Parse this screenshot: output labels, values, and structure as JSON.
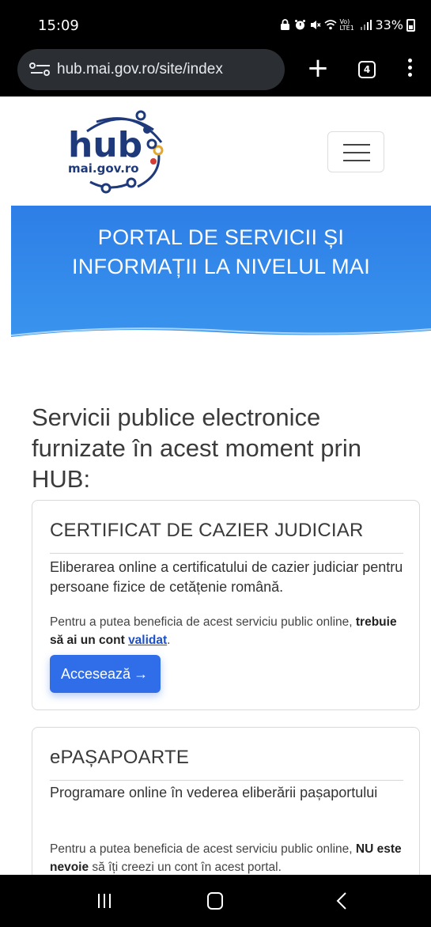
{
  "status_bar": {
    "time": "15:09",
    "network_label": "Vo) LTE1",
    "battery": "33%"
  },
  "browser": {
    "url": "hub.mai.gov.ro/site/index",
    "tabs_count": "4"
  },
  "logo": {
    "word": "hub",
    "domain": "mai.gov.ro",
    "colors": {
      "primary": "#1f3a7a",
      "accent_gold": "#e2a72e",
      "accent_red": "#d43d35"
    }
  },
  "hero": {
    "title": "PORTAL DE SERVICII ȘI INFORMAȚII LA NIVELUL MAI",
    "background": "#3a8de9"
  },
  "section": {
    "title": "Servicii publice electronice furnizate în acest moment prin HUB:"
  },
  "cards": [
    {
      "title": "CERTIFICAT DE CAZIER JUDICIAR",
      "description": "Eliberarea online a certificatului de cazier judiciar pentru persoane fizice de cetățenie română.",
      "note_prefix": "Pentru a putea beneficia de acest serviciu public online, ",
      "note_bold": "trebuie să ai un cont ",
      "note_link": "validat",
      "note_suffix": ".",
      "button_label": "Accesează",
      "button_icon": "arrow-right-icon"
    },
    {
      "title": "ePAȘAPOARTE",
      "description": "Programare online în vederea eliberării pașaportului",
      "note_prefix": "Pentru a putea beneficia de acest serviciu public online, ",
      "note_bold": "NU este nevoie",
      "note_suffix": " să îți creezi un cont în acest portal."
    }
  ]
}
